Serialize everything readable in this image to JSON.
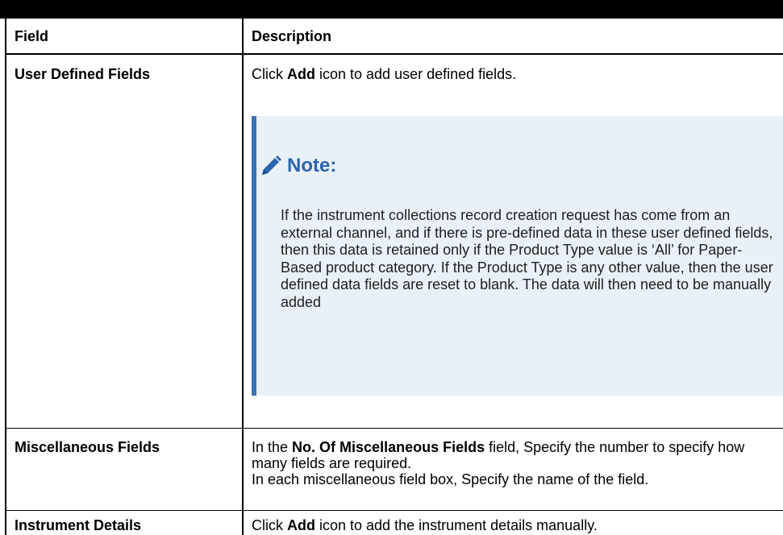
{
  "header": {
    "field": "Field",
    "description": "Description"
  },
  "rows": [
    {
      "field": "User Defined Fields",
      "desc": {
        "pre": "Click ",
        "bold": "Add",
        "post": " icon to add user defined fields."
      },
      "note": {
        "icon": "pencil-icon",
        "title": "Note:",
        "text": "If the instrument collections record creation request has come from an external channel, and if there is pre-defined data in these user defined fields, then this data is retained only if the Product Type value is ‘All’ for Paper-Based product category. If the Product Type is any other value, then the user defined data fields are reset to blank. The data will then need to be manually added"
      }
    },
    {
      "field": "Miscellaneous Fields",
      "desc": {
        "pre": "In the ",
        "bold": "No. Of Miscellaneous Fields",
        "post": " field, Specify the number to specify how many fields are required.",
        "line2": "In each miscellaneous field box, Specify the name of the field."
      }
    },
    {
      "field": "Instrument Details",
      "desc": {
        "pre": "Click ",
        "bold": "Add",
        "post": " icon to add the instrument details manually."
      }
    }
  ],
  "colors": {
    "border": "#000000",
    "note_bg": "#e9f0f8",
    "note_accent": "#3a73b8",
    "note_title": "#2a64ad"
  }
}
